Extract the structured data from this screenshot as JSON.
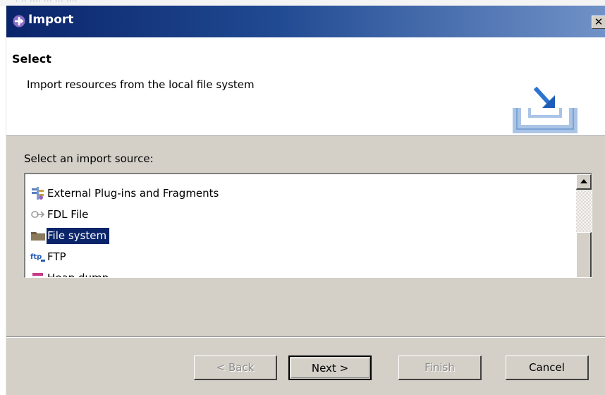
{
  "window": {
    "title": "Import",
    "close_glyph": "✕"
  },
  "header": {
    "title": "Select",
    "description": "Import resources from the local file system",
    "icon": "import-wizard-icon"
  },
  "content": {
    "label": "Select an import source:",
    "items": [
      {
        "label": "External Plug-ins and Fragments",
        "icon": "plugin-icon",
        "selected": false
      },
      {
        "label": "FDL File",
        "icon": "link-arrow-icon",
        "selected": false
      },
      {
        "label": "File system",
        "icon": "folder-icon",
        "selected": true
      },
      {
        "label": "FTP",
        "icon": "ftp-icon",
        "selected": false
      },
      {
        "label": "Heap dump",
        "icon": "heap-dump-icon",
        "selected": false
      }
    ]
  },
  "buttons": {
    "back": "< Back",
    "next": "Next >",
    "finish": "Finish",
    "cancel": "Cancel"
  },
  "colors": {
    "selection": "#0a246a",
    "titlebar_start": "#0a246a",
    "titlebar_end": "#7192c8",
    "dialog_bg": "#d4d0c8"
  }
}
